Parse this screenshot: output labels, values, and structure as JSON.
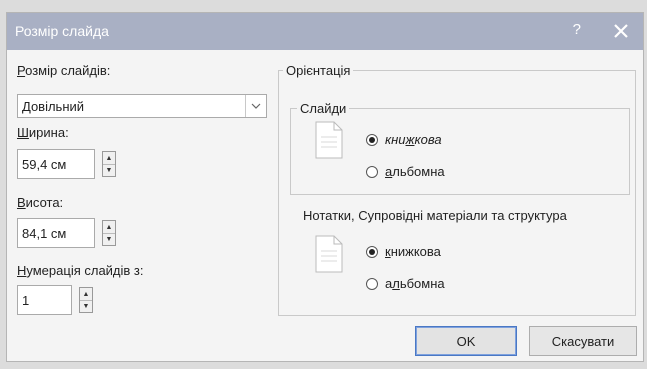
{
  "dialog": {
    "title": "Розмір слайда",
    "help": "?",
    "close_icon": "close-icon"
  },
  "slide_size": {
    "label_hotkey": "Р",
    "label_rest": "озмір слайдів:",
    "value": "Довільний"
  },
  "width": {
    "label_hotkey": "Ш",
    "label_rest": "ирина:",
    "value": "59,4 см"
  },
  "height": {
    "label_hotkey": "В",
    "label_rest": "исота:",
    "value": "84,1 см"
  },
  "numbering": {
    "label_hotkey": "Н",
    "label_rest": "умерація слайдів з:",
    "value": "1"
  },
  "orientation": {
    "title": "Орієнтація",
    "slides": {
      "title": "Слайди",
      "portrait_pre": "кни",
      "portrait_hot": "ж",
      "portrait_post": "кова",
      "landscape_hot": "а",
      "landscape_post": "льбомна",
      "selected": "portrait"
    },
    "notes": {
      "title": "Нотатки, Супровідні матеріали та структура",
      "portrait_hot": "к",
      "portrait_post": "нижкова",
      "landscape_pre": "а",
      "landscape_hot": "л",
      "landscape_post": "ьбомна",
      "selected": "portrait"
    }
  },
  "buttons": {
    "ok": "OK",
    "cancel": "Скасувати"
  },
  "colors": {
    "titlebar": "#a9b0c4",
    "accent": "#4a78c4"
  }
}
